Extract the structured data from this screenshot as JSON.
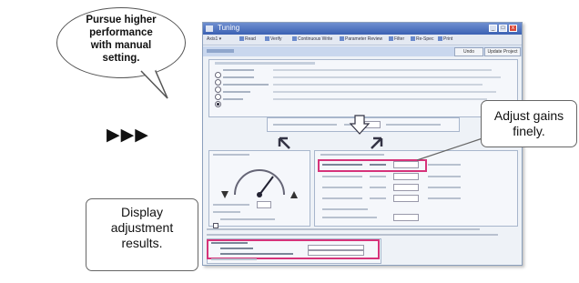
{
  "bubble": {
    "lines": [
      "Pursue higher",
      "performance",
      "with manual",
      "setting."
    ]
  },
  "arrows": "▶▶▶",
  "callouts": {
    "gains": {
      "lines": [
        "Adjust gains",
        "finely."
      ]
    },
    "display": {
      "lines": [
        "Display",
        "adjustment",
        "results."
      ]
    }
  },
  "colors": {
    "highlight": "#d6337a",
    "titlebar": "#3b61b3"
  },
  "window": {
    "title": "Tuning",
    "toolbar": [
      "Axis1",
      "Read",
      "Verify",
      "Continuous Write",
      "Parameter Review",
      "Filter",
      "Re-Spec",
      "Print"
    ],
    "buttons": [
      "Undo",
      "Update Project"
    ]
  }
}
